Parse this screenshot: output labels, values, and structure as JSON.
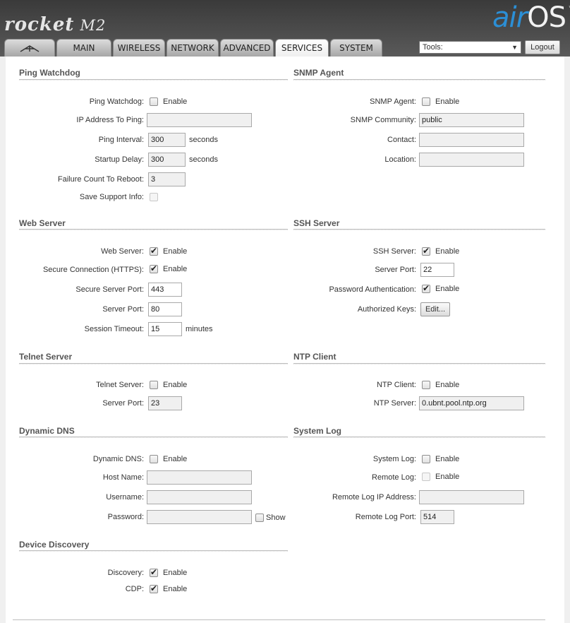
{
  "brand": {
    "product": "rocket",
    "model": "M2",
    "os_air": "air",
    "os_name": "OS",
    "tm": "™"
  },
  "tabs": [
    "MAIN",
    "WIRELESS",
    "NETWORK",
    "ADVANCED",
    "SERVICES",
    "SYSTEM"
  ],
  "tools": {
    "label": "Tools:",
    "arrow": "▼"
  },
  "logout": "Logout",
  "check": "✔",
  "ping": {
    "title": "Ping Watchdog",
    "watchdog_label": "Ping Watchdog:",
    "enable": "Enable",
    "ip_label": "IP Address To Ping:",
    "ip_value": "",
    "interval_label": "Ping Interval:",
    "interval_value": "300",
    "interval_unit": "seconds",
    "delay_label": "Startup Delay:",
    "delay_value": "300",
    "delay_unit": "seconds",
    "failure_label": "Failure Count To Reboot:",
    "failure_value": "3",
    "support_label": "Save Support Info:"
  },
  "snmp": {
    "title": "SNMP Agent",
    "agent_label": "SNMP Agent:",
    "enable": "Enable",
    "community_label": "SNMP Community:",
    "community_value": "public",
    "contact_label": "Contact:",
    "contact_value": "",
    "location_label": "Location:",
    "location_value": ""
  },
  "web": {
    "title": "Web Server",
    "server_label": "Web Server:",
    "enable": "Enable",
    "https_label": "Secure Connection (HTTPS):",
    "secure_port_label": "Secure Server Port:",
    "secure_port_value": "443",
    "port_label": "Server Port:",
    "port_value": "80",
    "timeout_label": "Session Timeout:",
    "timeout_value": "15",
    "timeout_unit": "minutes"
  },
  "ssh": {
    "title": "SSH Server",
    "server_label": "SSH Server:",
    "enable": "Enable",
    "port_label": "Server Port:",
    "port_value": "22",
    "password_label": "Password Authentication:",
    "keys_label": "Authorized Keys:",
    "edit_button": "Edit..."
  },
  "telnet": {
    "title": "Telnet Server",
    "server_label": "Telnet Server:",
    "enable": "Enable",
    "port_label": "Server Port:",
    "port_value": "23"
  },
  "ntp": {
    "title": "NTP Client",
    "client_label": "NTP Client:",
    "enable": "Enable",
    "server_label": "NTP Server:",
    "server_value": "0.ubnt.pool.ntp.org"
  },
  "ddns": {
    "title": "Dynamic DNS",
    "ddns_label": "Dynamic DNS:",
    "enable": "Enable",
    "host_label": "Host Name:",
    "host_value": "",
    "user_label": "Username:",
    "user_value": "",
    "pass_label": "Password:",
    "pass_value": "",
    "show": "Show"
  },
  "syslog": {
    "title": "System Log",
    "log_label": "System Log:",
    "enable": "Enable",
    "remote_label": "Remote Log:",
    "remote_ip_label": "Remote Log IP Address:",
    "remote_ip_value": "",
    "remote_port_label": "Remote Log Port:",
    "remote_port_value": "514"
  },
  "discovery": {
    "title": "Device Discovery",
    "discovery_label": "Discovery:",
    "enable": "Enable",
    "cdp_label": "CDP:"
  }
}
